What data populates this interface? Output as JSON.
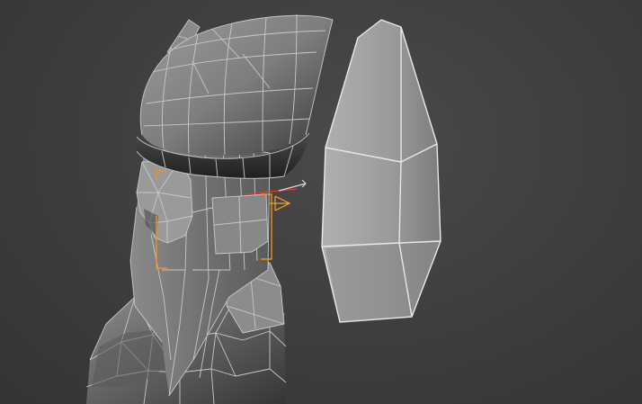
{
  "viewport": {
    "mode": "shaded-wireframe",
    "background": "#3f3f3f"
  },
  "model": {
    "wire_color": "#c8c8c8",
    "shade_light": "#a4a4a4",
    "shade_dark": "#2e2e2e"
  },
  "selected_object": {
    "shape": "gem-shaped flat panel",
    "wire_color": "#ffffff",
    "fill": "#9a9a9a"
  },
  "selection_brackets": {
    "color": "#f0901e"
  },
  "transform_gizmo": {
    "x_color": "#e53b2b",
    "y_color": "#f5a21f",
    "label_color": "#d8d8d8"
  }
}
